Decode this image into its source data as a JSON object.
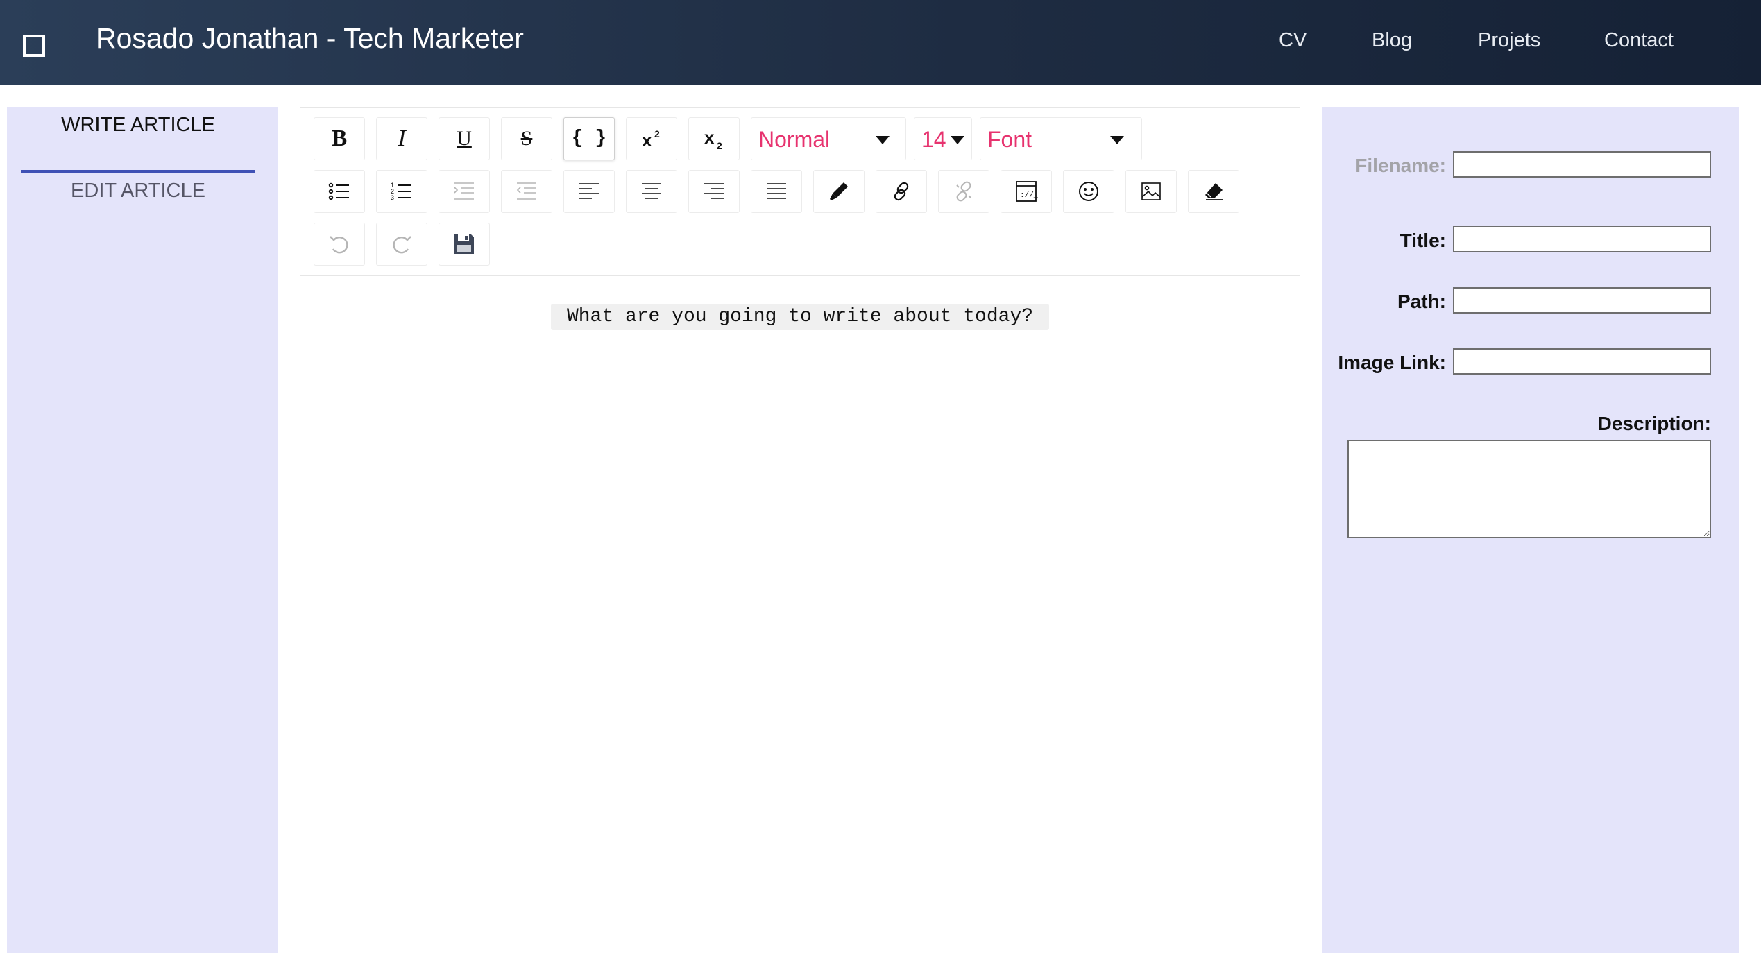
{
  "header": {
    "title": "Rosado Jonathan - Tech Marketer",
    "nav": [
      "CV",
      "Blog",
      "Projets",
      "Contact"
    ]
  },
  "sidebar": {
    "tabs": [
      "WRITE ARTICLE",
      "EDIT ARTICLE"
    ],
    "active_tab": "WRITE ARTICLE"
  },
  "toolbar": {
    "row1": [
      {
        "icon": "bold-icon",
        "label": "B"
      },
      {
        "icon": "italic-icon",
        "label": "I"
      },
      {
        "icon": "underline-icon",
        "label": "U"
      },
      {
        "icon": "strikethrough-icon",
        "label": "S"
      },
      {
        "icon": "code-block-icon",
        "label": "{ }",
        "active": true
      },
      {
        "icon": "superscript-icon"
      },
      {
        "icon": "subscript-icon"
      }
    ],
    "block_type": "Normal",
    "font_size": "14",
    "font_family": "Font",
    "row2": [
      "bulleted-list-icon",
      "numbered-list-icon",
      "indent-icon",
      "outdent-icon",
      "align-left-icon",
      "align-center-icon",
      "align-right-icon",
      "justify-icon",
      "color-picker-icon",
      "link-icon",
      "unlink-icon",
      "embed-icon",
      "emoji-icon",
      "image-icon",
      "eraser-icon"
    ],
    "row3": [
      "undo-icon",
      "redo-icon",
      "save-icon"
    ],
    "colors": {
      "dropdown_text": "#e7336f",
      "disabled_icon": "#b5b5b5"
    }
  },
  "editor": {
    "placeholder": "What are you going to write about today?"
  },
  "form": {
    "filename_label": "Filename:",
    "title_label": "Title:",
    "path_label": "Path:",
    "image_link_label": "Image Link:",
    "description_label": "Description:",
    "filename_value": "",
    "title_value": "",
    "path_value": "",
    "image_link_value": "",
    "description_value": ""
  },
  "colors": {
    "header_bg": "#1e2c42",
    "panel_bg": "#e4e4fa",
    "accent_underline": "#3f51b5"
  }
}
